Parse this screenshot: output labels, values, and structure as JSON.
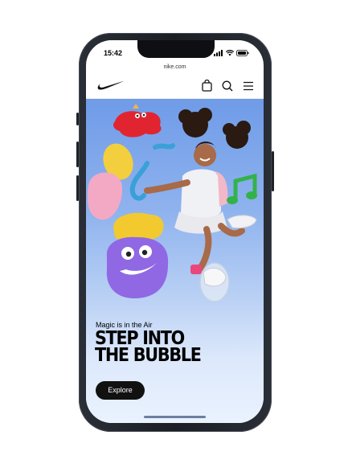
{
  "status_bar": {
    "time": "15:42"
  },
  "browser": {
    "url": "nike.com"
  },
  "nav": {
    "logo": "nike-swoosh-icon",
    "icons": [
      "bag-icon",
      "search-icon",
      "menu-icon"
    ]
  },
  "hero": {
    "eyebrow": "Magic is in the Air",
    "headline_line1": "STEP INTO",
    "headline_line2": "THE BUBBLE",
    "cta_label": "Explore"
  },
  "colors": {
    "phone_frame": "#1b1e24",
    "hero_top": "#6f9be8",
    "hero_bottom": "#eaf2fe",
    "cta_bg": "#111111",
    "cta_text": "#ffffff"
  }
}
